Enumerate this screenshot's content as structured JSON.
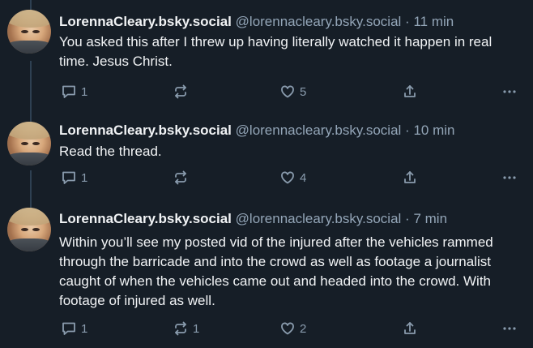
{
  "posts": [
    {
      "author": "LorennaCleary.bsky.social",
      "handle": "@lorennacleary.bsky.social",
      "separator": "·",
      "time": "11 min",
      "text": "You asked this after I threw up having literally watched it happen in real time. Jesus Christ.",
      "reply_count": "1",
      "repost_count": "",
      "like_count": "5"
    },
    {
      "author": "LorennaCleary.bsky.social",
      "handle": "@lorennacleary.bsky.social",
      "separator": "·",
      "time": "10 min",
      "text": "Read the thread.",
      "reply_count": "1",
      "repost_count": "",
      "like_count": "4"
    },
    {
      "author": "LorennaCleary.bsky.social",
      "handle": "@lorennacleary.bsky.social",
      "separator": "·",
      "time": "7 min",
      "text": "Within you’ll see my posted vid of the injured after the vehicles rammed through the barricade and into the crowd as well as footage a journalist caught of when the vehicles came out and headed into the crowd. With footage of injured as well.",
      "reply_count": "1",
      "repost_count": "1",
      "like_count": "2"
    }
  ],
  "icons": {
    "reply": "reply-icon",
    "repost": "repost-icon",
    "like": "heart-icon",
    "share": "share-icon",
    "more": "more-icon"
  },
  "colors": {
    "background": "#161e27",
    "text": "#f1f3f5",
    "muted": "#93a5b7",
    "thread_line": "#2e4052"
  }
}
